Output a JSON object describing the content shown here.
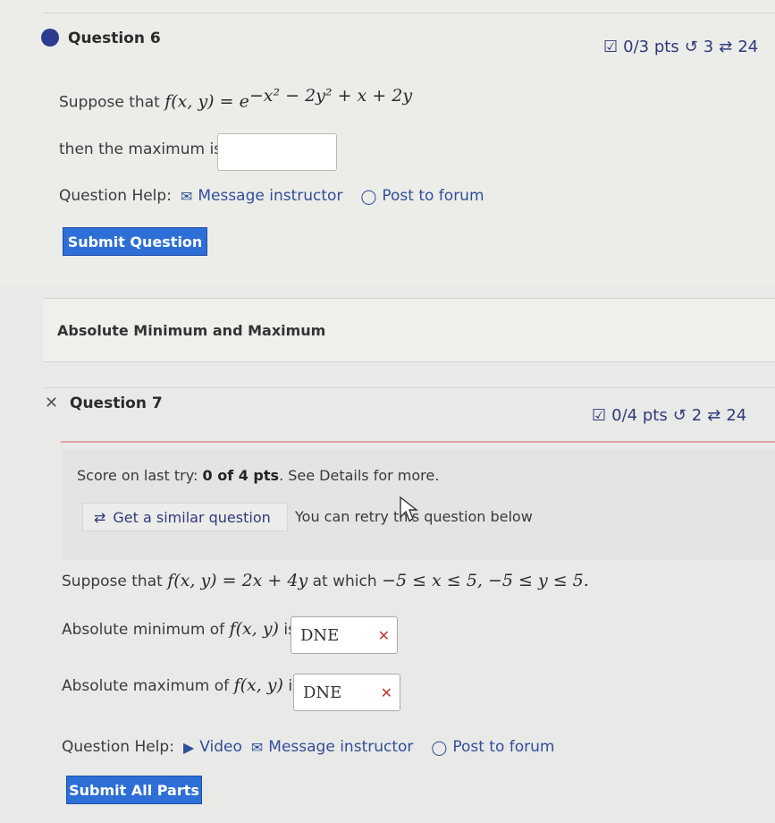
{
  "question6": {
    "title": "Question 6",
    "points": "0/3 pts",
    "retries": "3",
    "versions": "24",
    "prompt_prefix": "Suppose that",
    "function_lhs": "f(x, y) = e",
    "function_exponent": "−x² − 2y² + x + 2y",
    "answer_label": "then the maximum is",
    "answer_value": "",
    "help_label": "Question Help:",
    "message_link": "Message instructor",
    "forum_link": "Post to forum",
    "submit_label": "Submit Question"
  },
  "section": {
    "title": "Absolute Minimum and Maximum"
  },
  "question7": {
    "title": "Question 7",
    "points": "0/4 pts",
    "retries": "2",
    "versions": "24",
    "score_prefix": "Score on last try:",
    "score_value": "0 of 4 pts",
    "score_suffix": ". See Details for more.",
    "similar_button": "Get a similar question",
    "retry_note": "You can retry this question below",
    "prompt_prefix": "Suppose that",
    "function": "f(x, y) = 2x + 4y",
    "prompt_mid": "at which",
    "constraints": "−5 ≤ x ≤ 5,  −5 ≤ y ≤ 5.",
    "min_label_prefix": "Absolute minimum of",
    "min_label_fn": "f(x, y)",
    "min_label_suffix": "is",
    "min_value": "DNE",
    "max_label_prefix": "Absolute maximum of",
    "max_label_fn": "f(x, y)",
    "max_label_suffix": "is",
    "max_value": "DNE",
    "help_label": "Question Help:",
    "video_link": "Video",
    "message_link": "Message instructor",
    "forum_link": "Post to forum",
    "submit_label": "Submit All Parts"
  },
  "icons": {
    "dot_color": "#2c3a8f",
    "link_color": "#2f4f9a",
    "button_color": "#2d6fd6",
    "wrong_color": "#c0392b"
  }
}
